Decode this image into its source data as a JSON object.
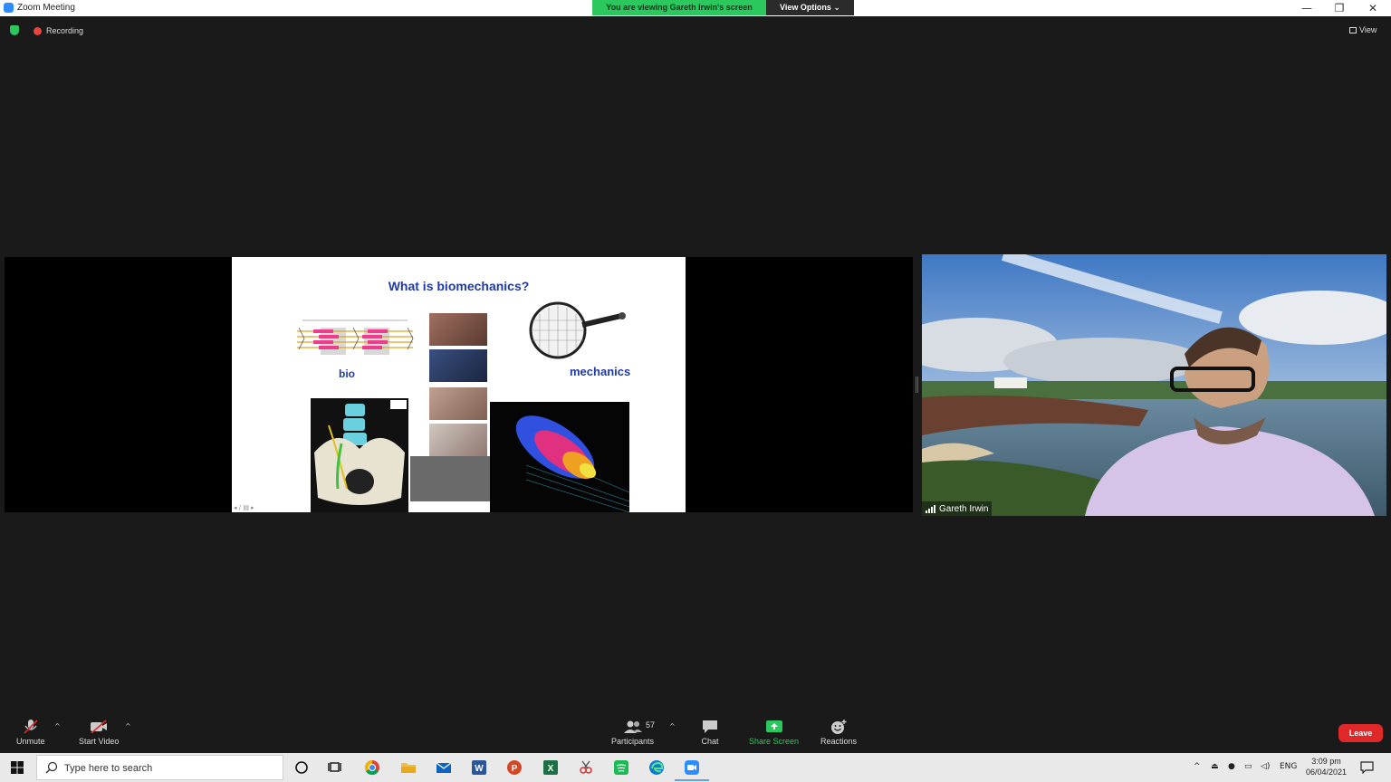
{
  "window": {
    "title": "Zoom Meeting",
    "minimize": "—",
    "restore": "❐",
    "close": "✕"
  },
  "banner": {
    "viewing_text": "You are viewing Gareth Irwin's screen",
    "view_options": "View Options ⌄"
  },
  "meeting": {
    "recording_label": "Recording",
    "view_label": "View"
  },
  "slide": {
    "title": "What is biomechanics?",
    "bio": "bio",
    "mechanics": "mechanics"
  },
  "video": {
    "participant_name": "Gareth Irwin"
  },
  "toolbar": {
    "unmute": "Unmute",
    "start_video": "Start Video",
    "participants": "Participants",
    "participant_count": "57",
    "chat": "Chat",
    "share_screen": "Share Screen",
    "reactions": "Reactions",
    "leave": "Leave"
  },
  "taskbar": {
    "search_placeholder": "Type here to search",
    "language": "ENG",
    "time": "3:09 pm",
    "date": "06/04/2021"
  },
  "colors": {
    "zoom_blue": "#2d8cff",
    "banner_green": "#2ac85d",
    "leave_red": "#e02828",
    "slide_title_blue": "#1f3aa6"
  }
}
